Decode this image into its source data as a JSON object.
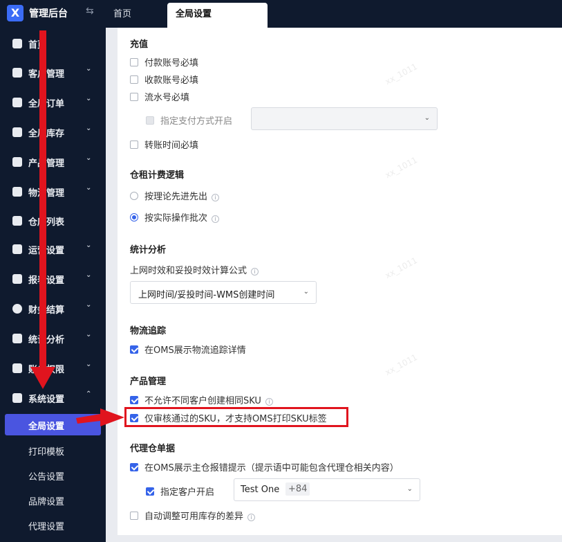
{
  "app": {
    "title": "管理后台",
    "logo_letter": "X"
  },
  "top_tabs": [
    {
      "label": "首页"
    },
    {
      "label": "全局设置"
    }
  ],
  "sidebar": {
    "items": [
      {
        "label": "首页"
      },
      {
        "label": "客户管理"
      },
      {
        "label": "全局订单"
      },
      {
        "label": "全局库存"
      },
      {
        "label": "产品管理"
      },
      {
        "label": "物流管理"
      },
      {
        "label": "仓库列表"
      },
      {
        "label": "运营设置"
      },
      {
        "label": "报表设置"
      },
      {
        "label": "财务结算"
      },
      {
        "label": "统计分析"
      },
      {
        "label": "账户权限"
      },
      {
        "label": "系统设置"
      }
    ],
    "sub_items": [
      {
        "label": "全局设置"
      },
      {
        "label": "打印模板"
      },
      {
        "label": "公告设置"
      },
      {
        "label": "品牌设置"
      },
      {
        "label": "代理设置"
      }
    ]
  },
  "sections": {
    "recharge": {
      "title": "充值",
      "options": [
        "付款账号必填",
        "收款账号必填",
        "流水号必填"
      ],
      "sub_option": "指定支付方式开启",
      "last_option": "转账时间必填"
    },
    "rent": {
      "title": "仓租计费逻辑",
      "options": [
        "按理论先进先出",
        "按实际操作批次"
      ]
    },
    "stats": {
      "title": "统计分析",
      "label": "上网时效和妥投时效计算公式",
      "select_value": "上网时间/妥投时间-WMS创建时间"
    },
    "tracking": {
      "title": "物流追踪",
      "option": "在OMS展示物流追踪详情"
    },
    "product": {
      "title": "产品管理",
      "options": [
        "不允许不同客户创建相同SKU",
        "仅审核通过的SKU，才支持OMS打印SKU标签"
      ]
    },
    "proxy": {
      "title": "代理仓单据",
      "option": "在OMS展示主仓报错提示（提示语中可能包含代理仓相关内容）",
      "sub_option": "指定客户开启",
      "select_value": "Test One",
      "select_more": "+84",
      "last_option": "自动调整可用库存的差异"
    }
  },
  "watermark_text": "xx_1011",
  "colors": {
    "accent": "#3563e9",
    "sidebar_bg": "#0f1a2e",
    "active_item": "#4a55e0",
    "annotation": "#e0141e"
  }
}
